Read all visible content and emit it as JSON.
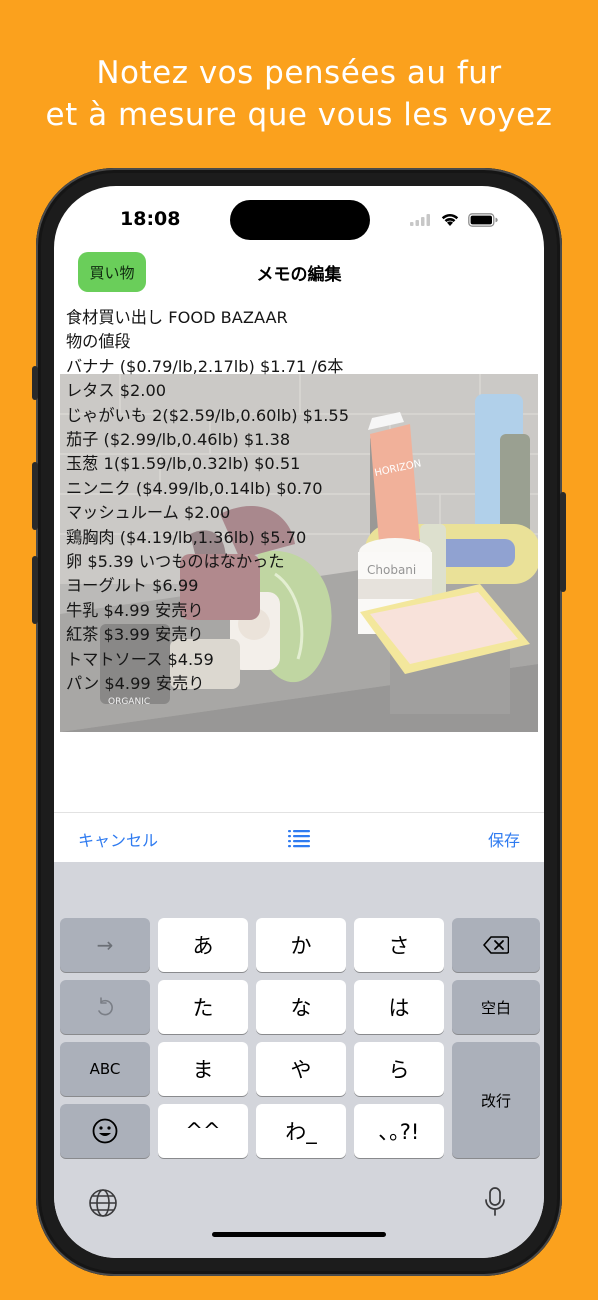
{
  "headline": {
    "line1": "Notez vos pensées au fur",
    "line2": "et à mesure que vous les voyez"
  },
  "status_bar": {
    "time": "18:08"
  },
  "nav": {
    "tag_label": "買い物",
    "title": "メモの編集"
  },
  "note": {
    "lines": [
      "食材買い出し FOOD BAZAAR",
      "物の値段",
      "バナナ ($0.79/lb,2.17lb) $1.71 /6本",
      "レタス $2.00",
      "じゃがいも 2($2.59/lb,0.60lb) $1.55",
      "茄子 ($2.99/lb,0.46lb) $1.38",
      "玉葱 1($1.59/lb,0.32lb) $0.51",
      "ニンニク ($4.99/lb,0.14lb) $0.70",
      "マッシュルーム $2.00",
      "鶏胸肉 ($4.19/lb,1.36lb) $5.70",
      "卵 $5.39 いつものはなかった",
      "ヨーグルト $6.99",
      "牛乳 $4.99 安売り",
      "紅茶 $3.99 安売り",
      "トマトソース $4.59",
      "パン $4.99 安売り"
    ]
  },
  "photo": {
    "labels": {
      "horizon": "HORIZON",
      "chobani": "Chobani",
      "organic": "ORGANIC"
    }
  },
  "toolbar": {
    "cancel_label": "キャンセル",
    "list_icon": "list-icon",
    "save_label": "保存"
  },
  "keyboard": {
    "row1": [
      "→",
      "あ",
      "か",
      "さ",
      "⌫"
    ],
    "row2": [
      "↺",
      "た",
      "な",
      "は",
      "空白"
    ],
    "row3": [
      "ABC",
      "ま",
      "や",
      "ら",
      "改行"
    ],
    "row4": [
      "☺",
      "^^",
      "わ_",
      "､｡?!"
    ],
    "accent_color": "#2F7BF0"
  }
}
